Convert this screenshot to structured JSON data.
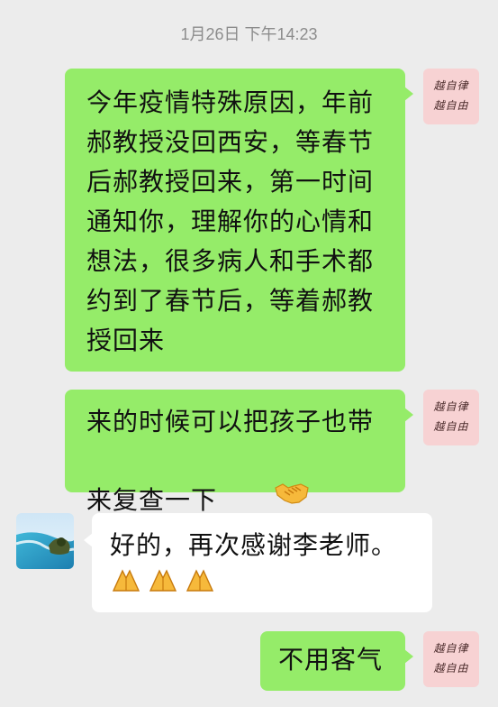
{
  "chat": {
    "timestamp": "1月26日 下午14:23",
    "messages": [
      {
        "side": "out",
        "text": "今年疫情特殊原因，年前\n郝教授没回西安，等春节\n后郝教授回来，第一时间\n通知你，理解你的心情和\n想法，很多病人和手术都\n约到了春节后，等着郝教\n授回来"
      },
      {
        "side": "out",
        "text": "来的时候可以把孩子也带\n来复查一下",
        "emoji": "handshake-emoji"
      },
      {
        "side": "in",
        "text": "好的，再次感谢李老师。",
        "emoji": "folded-hands-emoji x3"
      },
      {
        "side": "out",
        "text": "不用客气"
      }
    ]
  },
  "avatars": {
    "self": {
      "line1": "越自律",
      "line2": "越自由",
      "bg_color": "#f7d2d3"
    },
    "other": {
      "icon": "beach-island-photo"
    }
  },
  "colors": {
    "background": "#ececec",
    "outgoing_bubble": "#95ec69",
    "incoming_bubble": "#ffffff",
    "timestamp_text": "#8c8c8c"
  }
}
